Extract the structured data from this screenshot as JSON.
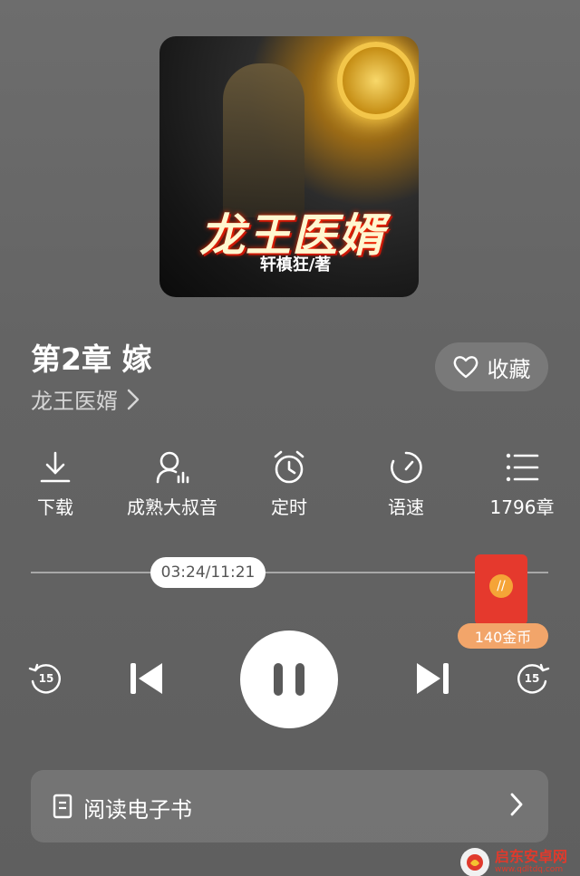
{
  "cover": {
    "title": "龙王医婿",
    "author": "轩槙狂/著"
  },
  "chapter": {
    "title": "第2章 嫁",
    "book_name": "龙王医婿"
  },
  "favorite_label": "收藏",
  "actions": [
    {
      "label": "下载",
      "icon": "download-icon"
    },
    {
      "label": "成熟大叔音",
      "icon": "voice-icon"
    },
    {
      "label": "定时",
      "icon": "alarm-icon"
    },
    {
      "label": "语速",
      "icon": "speed-icon"
    },
    {
      "label": "1796章",
      "icon": "list-icon"
    }
  ],
  "player": {
    "time": "03:24/11:21",
    "progress_fraction": 0.3,
    "rewind_seconds": "15",
    "forward_seconds": "15"
  },
  "reward": {
    "coins_label": "140金币",
    "colors": {
      "packet": "#e5392d",
      "badge": "#f2a56a"
    }
  },
  "ebook_label": "阅读电子书",
  "watermark": {
    "main": "启东安卓网",
    "sub": "www.qdltdq.com"
  }
}
